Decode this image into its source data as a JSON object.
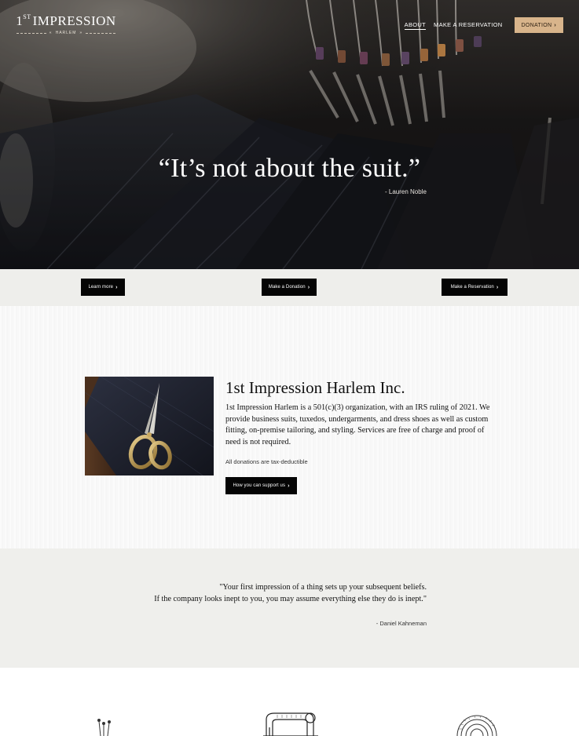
{
  "brand": {
    "logo_prefix": "1",
    "logo_superscript": "ST",
    "logo_main": "IMPRESSION",
    "logo_sub": "HARLEM"
  },
  "nav": {
    "about": "ABOUT",
    "reservation": "MAKE A RESERVATION",
    "donation": "DONATION"
  },
  "hero": {
    "quote": "“It’s not about the suit.”",
    "author": "- Lauren Noble"
  },
  "cta_strip": {
    "learn_more": "Learn more",
    "make_donation": "Make a Donation",
    "make_reservation": "Make a Reservation"
  },
  "about": {
    "title": "1st Impression Harlem Inc.",
    "body": "1st Impression Harlem is a 501(c)(3) organization, with an IRS ruling of 2021. We provide business suits, tuxedos, undergarments, and dress shoes as well as custom fitting, on-premise tailoring, and styling. Services are free of charge and proof of need is not required.",
    "note": "All donations are tax-deductible",
    "support_button": "How you can support us"
  },
  "quote_section": {
    "line1": "\"Your first impression of a thing sets up your subsequent beliefs.",
    "line2": "If the company looks inept to you, you may assume everything else they do is inept.\"",
    "author": "- Daniel Kahneman"
  },
  "icons": [
    "pins-icon",
    "sewing-machine-icon",
    "tape-measure-icon"
  ],
  "colors": {
    "accent_tan": "#d8b48b",
    "button_black": "#050505",
    "strip_bg": "#eeeeeb"
  }
}
